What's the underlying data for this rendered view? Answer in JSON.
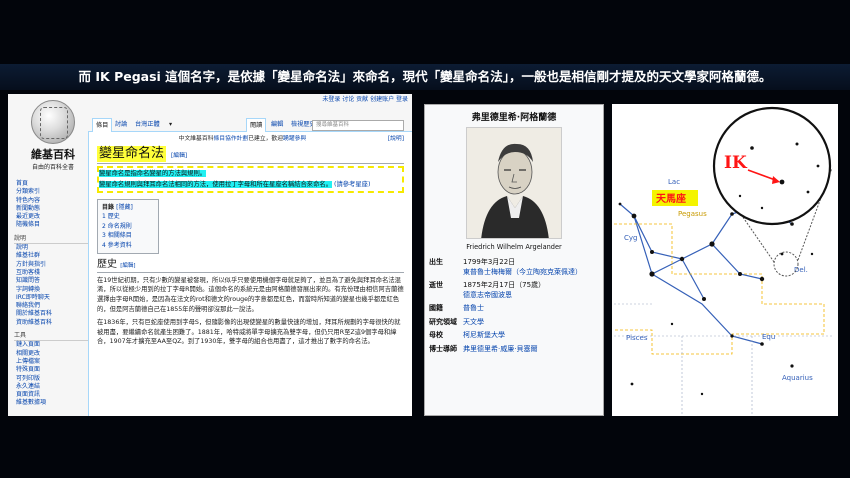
{
  "caption": "而 IK Pegasi 這個名字，是依據「變星命名法」來命名，現代「變星命名法」，一般也是相信剛才提及的天文學家阿格蘭德。",
  "wiki": {
    "topbar": "未登录 讨论 贡献 创建账户 登录",
    "logo_title": "維基百科",
    "logo_sub": "自由的百科全書",
    "sidebar_nav": [
      "首頁",
      "分類索引",
      "特色內容",
      "新聞動態",
      "最近更改",
      "隨機條目"
    ],
    "sidebar_help_heading": "說明",
    "sidebar_help": [
      "說明",
      "維基社群",
      "方針與指引",
      "互助客棧",
      "知識問答",
      "字詞轉換",
      "IRC即時聊天",
      "聯絡我們",
      "關於維基百科",
      "資助維基百科"
    ],
    "sidebar_tools_heading": "工具",
    "sidebar_tools": [
      "鏈入頁面",
      "相關更改",
      "上傳檔案",
      "特殊頁面",
      "可列印版",
      "永久連結",
      "頁面資訊",
      "維基數據項"
    ],
    "tabs": {
      "article": "條目",
      "talk": "討論",
      "variant": "台灣正體",
      "read": "閱讀",
      "edit": "編輯",
      "history": "檢視歷史"
    },
    "search_placeholder": "搜尋維基百科",
    "notice_pre": "中文維基百科",
    "notice_link": "條目協作計劃",
    "notice_post": "已建立，歡迎",
    "notice_link2": "踴躍參與",
    "help_link": "[說明]",
    "page_title": "變星命名法",
    "edit_label": "[編輯]",
    "lead1": "變星命名是指命名變星的方法與規則。",
    "lead2": "變星命名規則與拜耳命名法相同的方法，使用拉丁字母和所在星座名稱結合來命名。",
    "lead2_tail": "(請參考星座)",
    "toc_title": "目錄",
    "toc_toggle": "[隱藏]",
    "toc": [
      "1 歷史",
      "2 命名規則",
      "3 相關條目",
      "4 參考資料"
    ],
    "history_heading": "歷史",
    "history_edit": "[編輯]",
    "history_p1": "在19世紀初期，只有少數的變星被發現，所以似乎只要使用機個字母就足夠了，並且為了避免與拜耳命名法混淆，所以從極少用到的拉丁字母R開始。這個命名的系統元是由阿格蘭德發展出來的。有充份理由相信阿吉蘭德選擇由字母R開始，是因為在法文的rot和德文的rouge的字意都是紅色，而當時所知道的變星也幾乎都是紅色的，但是阿吉蘭德自己在1855年的聲明卻沒那此一說法。",
    "history_p2": "在1836年，只有巨蛇座使用到字母S，但隨影像的出現使變星的數量快速的增加，拜耳所規劃的字母很快的就被用盡，要繼續命名就產生困難了。1881年，哈特威將單字母擴充為雙字母，但仍只用R至Z這9個字母和緯合，1907年才擴充至AA至QZ。到了1930年，雙字母的組合也用盡了，這才推出了數字的命名法。"
  },
  "infobox": {
    "title": "弗里德里希·阿格蘭德",
    "caption": "Friedrich Wilhelm Argelander",
    "rows": [
      {
        "k": "出生",
        "v": "1799年3月22日",
        "v2": "東普魯士梅梅爾（今立陶宛克萊佩達）"
      },
      {
        "k": "逝世",
        "v": "1875年2月17日（75歲）",
        "v2": "德意志帝國波恩"
      },
      {
        "k": "國籍",
        "v": "普魯士"
      },
      {
        "k": "研究領域",
        "v": "天文學"
      },
      {
        "k": "母校",
        "v": "柯尼斯堡大學"
      },
      {
        "k": "博士導師",
        "v": "弗里德里希·威廉·貝塞爾"
      }
    ]
  },
  "starchart": {
    "ik_label": "IK",
    "pegasus_cn": "天馬座",
    "pegasus_en": "Pegasus",
    "labels": [
      "Pisces",
      "Equ",
      "Aquarius",
      "Del.",
      "Lac",
      "Cyg"
    ],
    "colors": {
      "accent": "#ff1515",
      "label_bg": "#f4f400",
      "lines": "#3560b8"
    }
  }
}
